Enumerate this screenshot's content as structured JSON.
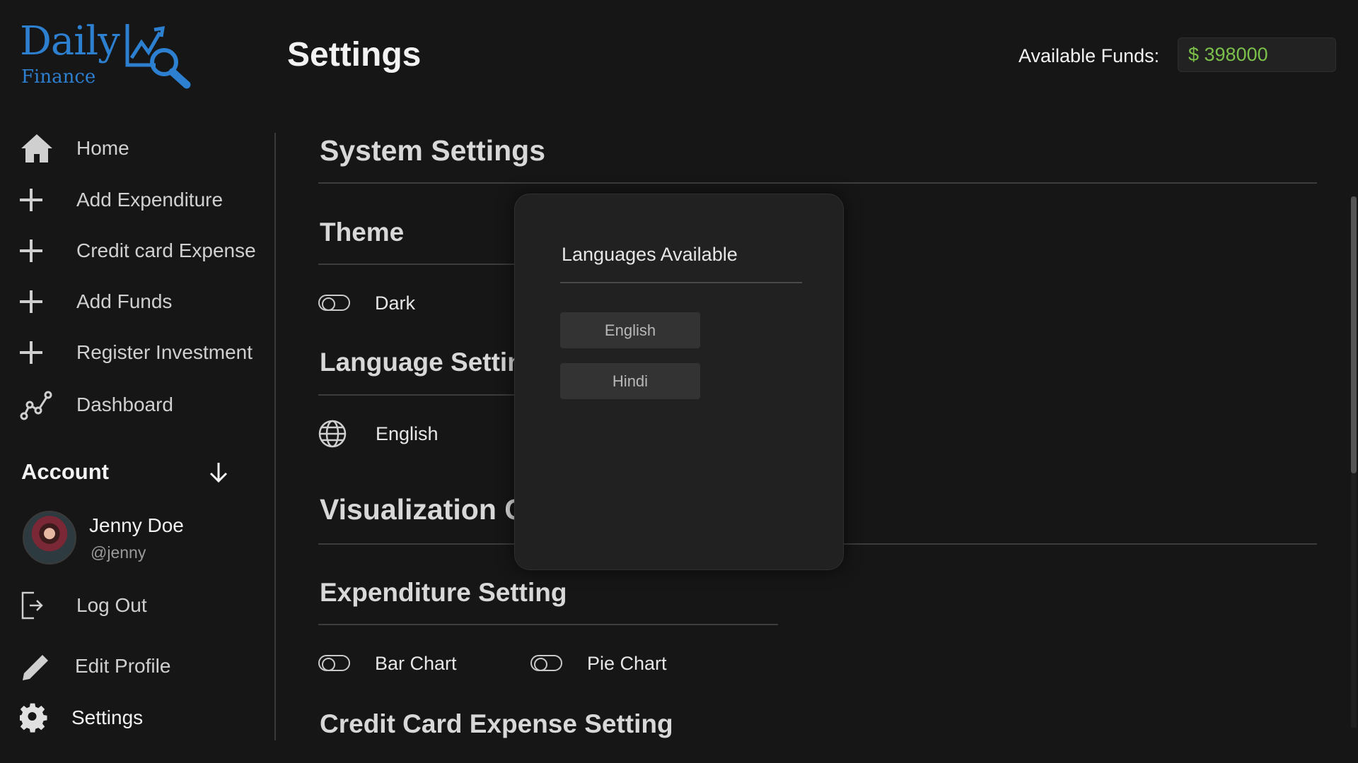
{
  "logo": {
    "line1": "Daily",
    "line2": "Finance"
  },
  "header": {
    "title": "Settings",
    "funds_label": "Available Funds:",
    "funds_value": "$ 398000"
  },
  "sidebar": {
    "items": [
      {
        "label": "Home",
        "icon": "home-icon"
      },
      {
        "label": "Add Expenditure",
        "icon": "plus-icon"
      },
      {
        "label": "Credit card Expense",
        "icon": "plus-icon"
      },
      {
        "label": "Add Funds",
        "icon": "plus-icon"
      },
      {
        "label": "Register Investment",
        "icon": "plus-icon"
      },
      {
        "label": "Dashboard",
        "icon": "chart-line-icon"
      }
    ],
    "account": {
      "header": "Account",
      "name": "Jenny Doe",
      "handle": "@jenny",
      "logout": "Log Out",
      "edit_profile": "Edit Profile",
      "settings": "Settings"
    }
  },
  "main": {
    "system_settings": "System Settings",
    "theme": {
      "title": "Theme",
      "option": "Dark"
    },
    "language": {
      "title": "Language Settin",
      "current": "English"
    },
    "visualization": {
      "title": "Visualization G"
    },
    "expenditure": {
      "title": "Expenditure Setting",
      "option1": "Bar Chart",
      "option2": "Pie Chart"
    },
    "credit_card": {
      "title": "Credit Card Expense Setting"
    }
  },
  "popup": {
    "title": "Languages Available",
    "options": [
      "English",
      "Hindi"
    ]
  },
  "colors": {
    "background": "#161616",
    "logo_blue": "#2d7fd0",
    "funds_green": "#7cc04b",
    "popup_bg": "#212121"
  }
}
